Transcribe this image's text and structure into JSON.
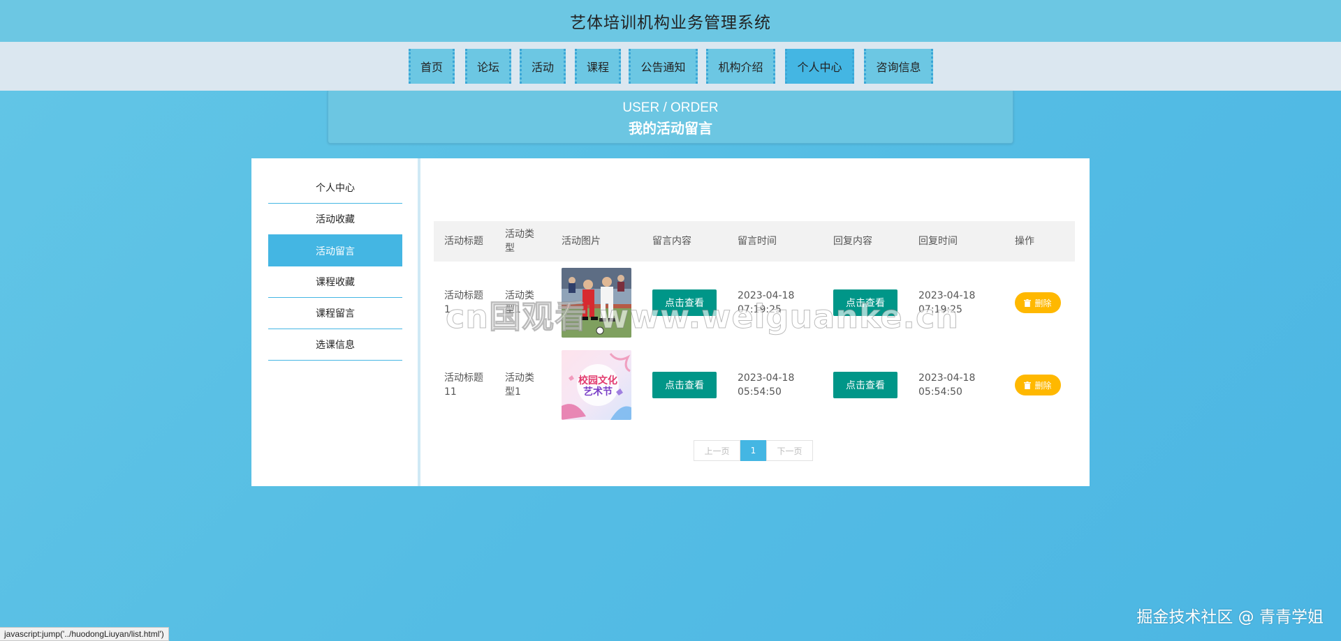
{
  "header": {
    "title": "艺体培训机构业务管理系统"
  },
  "nav": {
    "items": [
      {
        "label": "首页",
        "active": false
      },
      {
        "label": "论坛",
        "active": false
      },
      {
        "label": "活动",
        "active": false
      },
      {
        "label": "课程",
        "active": false
      },
      {
        "label": "公告通知",
        "active": false
      },
      {
        "label": "机构介绍",
        "active": false
      },
      {
        "label": "个人中心",
        "active": true
      },
      {
        "label": "咨询信息",
        "active": false
      }
    ]
  },
  "banner": {
    "en": "USER / ORDER",
    "cn": "我的活动留言"
  },
  "sidebar": {
    "items": [
      {
        "label": "个人中心",
        "active": false
      },
      {
        "label": "活动收藏",
        "active": false
      },
      {
        "label": "活动留言",
        "active": true
      },
      {
        "label": "课程收藏",
        "active": false
      },
      {
        "label": "课程留言",
        "active": false
      },
      {
        "label": "选课信息",
        "active": false
      }
    ]
  },
  "table": {
    "headers": [
      "活动标题",
      "活动类型",
      "活动图片",
      "留言内容",
      "留言时间",
      "回复内容",
      "回复时间",
      "操作"
    ],
    "rows": [
      {
        "title": "活动标题1",
        "type": "活动类型1",
        "image": "soccer-photo",
        "content_btn": "点击查看",
        "time": "2023-04-18 07:19:25",
        "reply_btn": "点击查看",
        "reply_time": "2023-04-18 07:19:25",
        "delete_btn": "删除"
      },
      {
        "title": "活动标题11",
        "type": "活动类型1",
        "image": "art-festival-poster",
        "content_btn": "点击查看",
        "time": "2023-04-18 05:54:50",
        "reply_btn": "点击查看",
        "reply_time": "2023-04-18 05:54:50",
        "delete_btn": "删除"
      }
    ]
  },
  "poster": {
    "line1": "校园文化",
    "line2": "艺术节"
  },
  "pagination": {
    "prev": "上一页",
    "current": "1",
    "next": "下一页"
  },
  "watermarks": {
    "center": "cn国观看 www.weiguanke.cn",
    "corner": "掘金技术社区 @ 青青学姐"
  },
  "status_bar": {
    "text": "javascript:jump('../huodongLiuyan/list.html')"
  },
  "colors": {
    "accent": "#44b6e3",
    "header": "#6cc7e3",
    "view_button": "#009688",
    "delete_button": "#ffb800"
  }
}
